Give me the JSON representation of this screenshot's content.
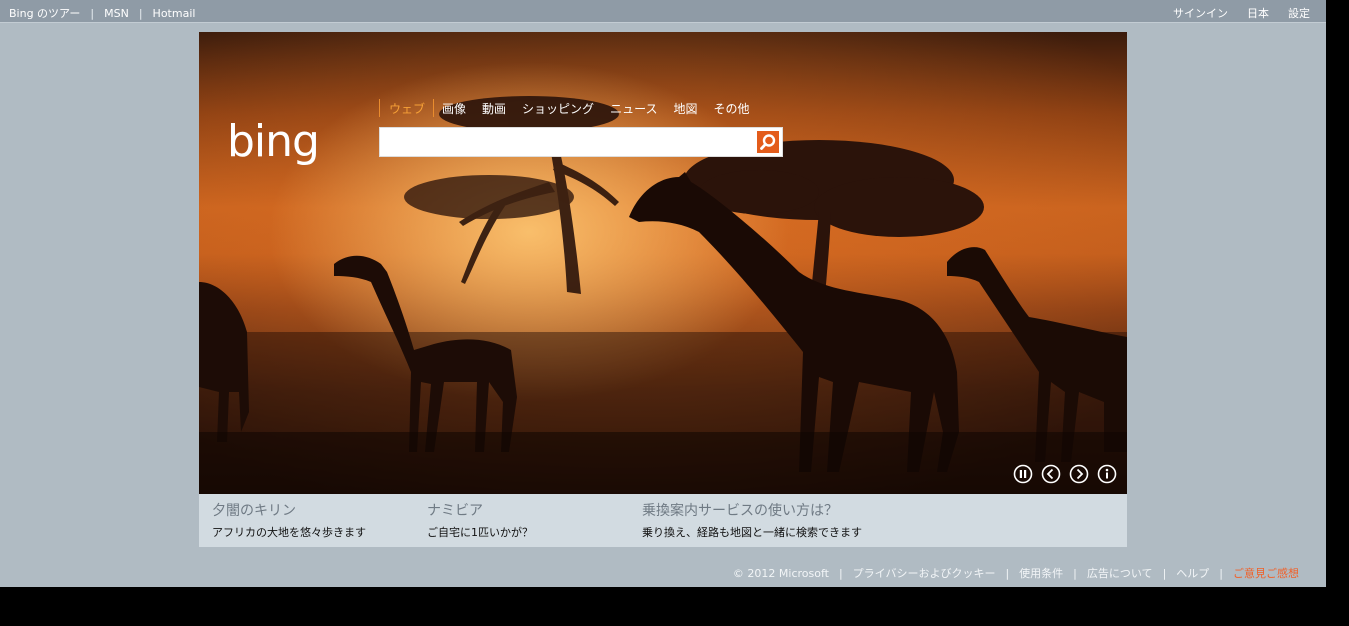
{
  "topbar": {
    "left_links": [
      "Bing のツアー",
      "MSN",
      "Hotmail"
    ],
    "separator": "|",
    "right_links": [
      "サインイン",
      "日本",
      "設定"
    ]
  },
  "search": {
    "tabs": [
      "ウェブ",
      "画像",
      "動画",
      "ショッピング",
      "ニュース",
      "地図",
      "その他"
    ],
    "active_tab": "ウェブ",
    "query": "",
    "button_icon": "search-icon"
  },
  "logo": {
    "text": "bing"
  },
  "hero_controls": [
    "pause-icon",
    "previous-icon",
    "next-icon",
    "info-icon"
  ],
  "captions": [
    {
      "title": "夕闇のキリン",
      "subtitle": "アフリカの大地を悠々歩きます"
    },
    {
      "title": "ナミビア",
      "subtitle": "ご自宅に1匹いかが？"
    },
    {
      "title": "乗換案内サービスの使い方は？",
      "subtitle": "乗り換え、経路も地図と一緒に検索できます"
    }
  ],
  "footer": {
    "copyright": "© 2012 Microsoft",
    "links": [
      "プライバシーおよびクッキー",
      "使用条件",
      "広告について",
      "ヘルプ"
    ],
    "feedback": "ご意見ご感想",
    "separator": "|"
  },
  "colors": {
    "accent": "#f7a137",
    "search_button": "#e35c1b",
    "feedback": "#f0612a"
  }
}
